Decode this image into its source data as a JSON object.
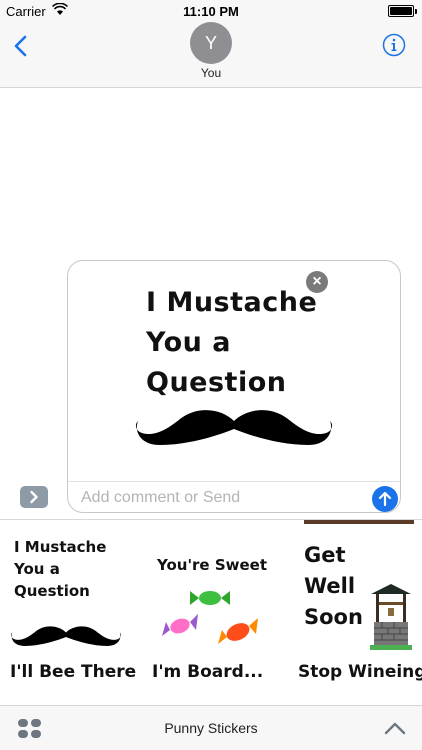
{
  "status_bar": {
    "carrier": "Carrier",
    "time": "11:10 PM",
    "wifi_icon": "wifi-icon",
    "battery_icon": "battery-icon"
  },
  "header": {
    "back_icon": "chevron-left-icon",
    "avatar_initial": "Y",
    "contact_name": "You",
    "info_icon": "info-icon",
    "accent_color": "#1a73e8"
  },
  "compose": {
    "sticker": {
      "line1": "I Mustache",
      "line2": "You a",
      "line3": "Question"
    },
    "remove_icon": "close-icon",
    "comment_placeholder": "Add comment or Send",
    "send_icon": "arrow-up-icon"
  },
  "expand_icon": "chevron-right-icon",
  "sticker_grid": {
    "cells": [
      {
        "line1": "I Mustache",
        "line2": "You a",
        "line3": "Question"
      },
      {
        "text": "You're Sweet"
      },
      {
        "line1": "Get",
        "line2": "Well",
        "line3": "Soon"
      }
    ],
    "row2": [
      "I'll Bee There",
      "I'm Board...",
      "Stop Wineing"
    ]
  },
  "bottom_bar": {
    "apps_icon": "app-drawer-icon",
    "title": "Punny Stickers",
    "collapse_icon": "chevron-up-icon"
  }
}
